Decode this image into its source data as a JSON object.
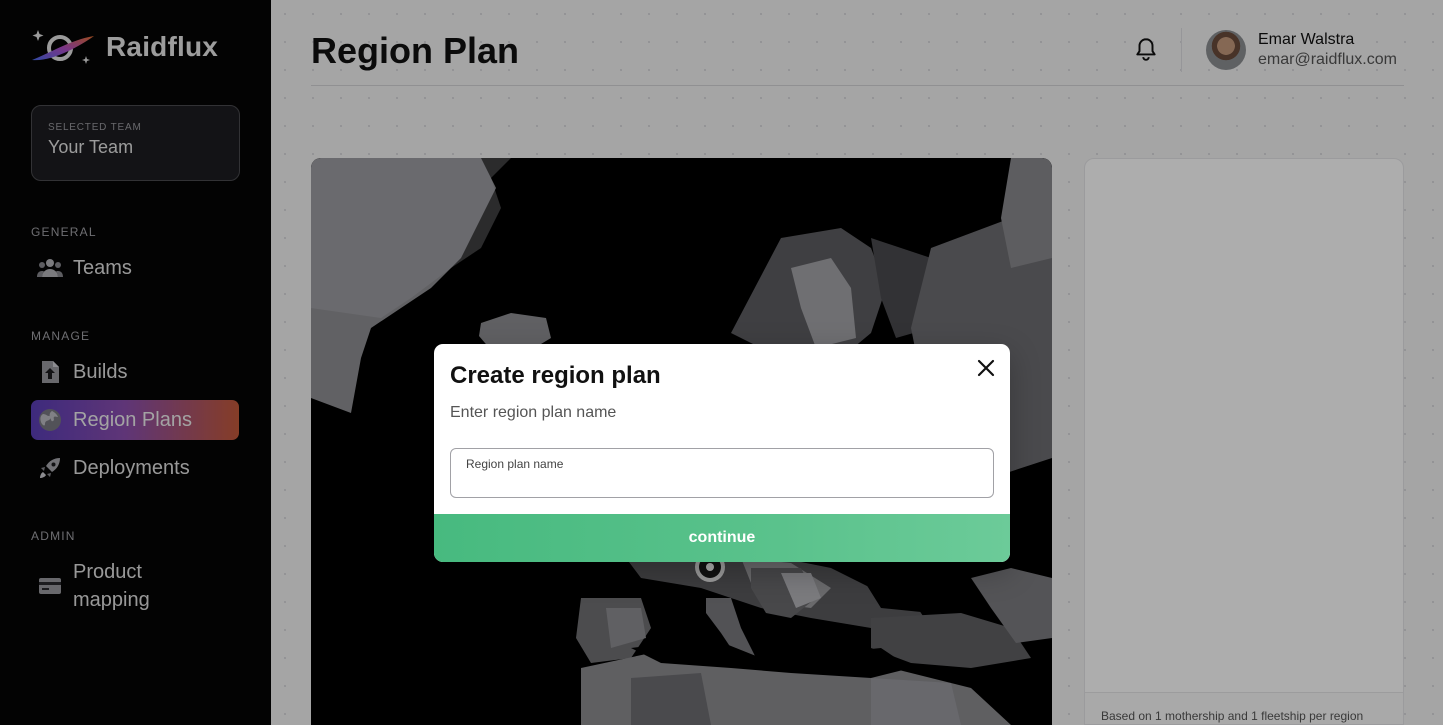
{
  "brand": {
    "name": "Raidflux"
  },
  "sidebar": {
    "team_caption": "SELECTED TEAM",
    "team_name": "Your Team",
    "sections": {
      "general": "GENERAL",
      "manage": "MANAGE",
      "admin": "ADMIN"
    },
    "items": {
      "teams": "Teams",
      "builds": "Builds",
      "region_plans": "Region Plans",
      "deployments": "Deployments",
      "product_mapping_line1": "Product",
      "product_mapping_line2": "mapping"
    }
  },
  "header": {
    "title": "Region Plan",
    "user_name": "Emar Walstra",
    "user_email": "emar@raidflux.com"
  },
  "side_panel": {
    "footer_text": "Based on 1 mothership and 1 fleetship per region"
  },
  "modal": {
    "title": "Create region plan",
    "subtitle": "Enter region plan name",
    "field_label": "Region plan name",
    "field_value": "",
    "continue_label": "continue"
  },
  "colors": {
    "active_gradient_start": "#5b3fb8",
    "active_gradient_end": "#c55a3a",
    "continue_green": "#52bf88"
  }
}
